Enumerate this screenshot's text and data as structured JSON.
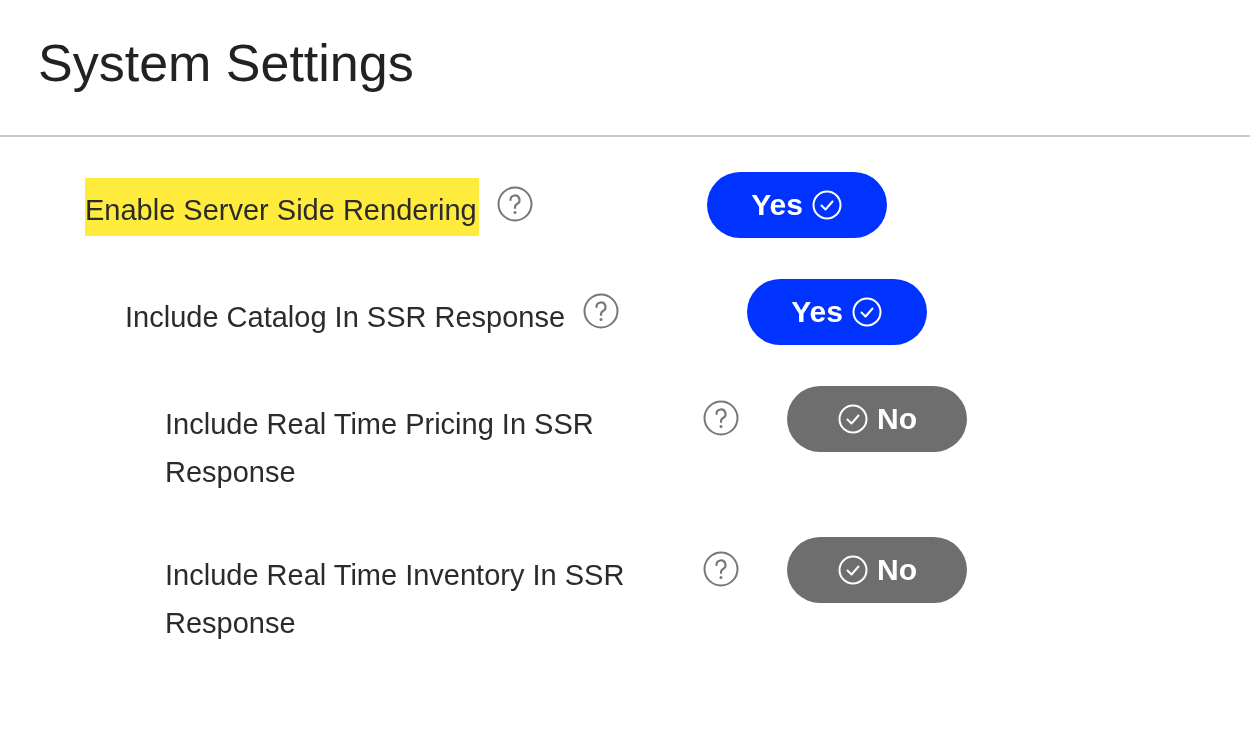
{
  "title": "System Settings",
  "settings": [
    {
      "label": "Enable Server Side Rendering",
      "highlighted": true,
      "toggle": {
        "label": "Yes",
        "on": true
      },
      "children": [
        {
          "label": "Include Catalog In SSR Response",
          "highlighted": false,
          "toggle": {
            "label": "Yes",
            "on": true
          },
          "children": [
            {
              "label": "Include Real Time Pricing In SSR Response",
              "highlighted": false,
              "toggle": {
                "label": "No",
                "on": false
              }
            },
            {
              "label": "Include Real Time Inventory In SSR Response",
              "highlighted": false,
              "toggle": {
                "label": "No",
                "on": false
              }
            }
          ]
        }
      ]
    }
  ]
}
